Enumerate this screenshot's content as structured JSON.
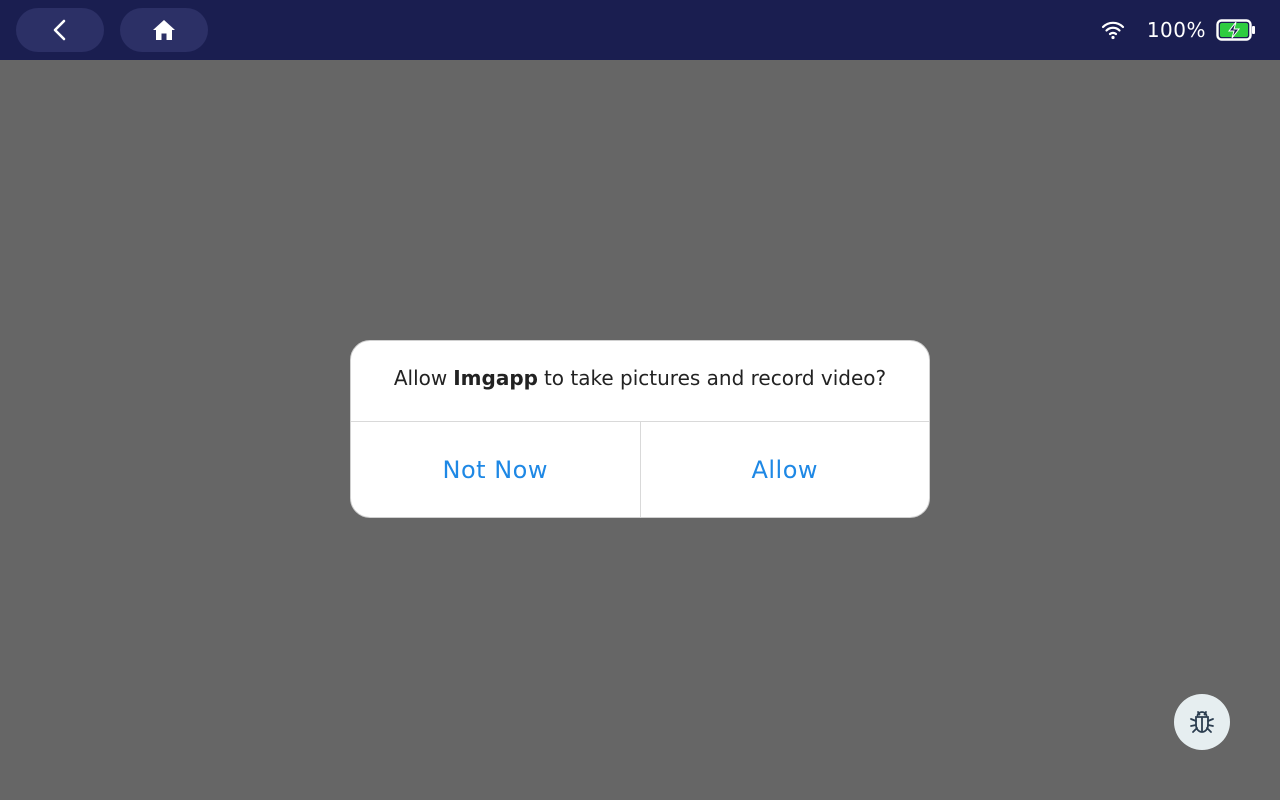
{
  "topbar": {
    "back_icon": "chevron-left-icon",
    "home_icon": "home-icon",
    "wifi_icon": "wifi-icon",
    "battery_percent": "100%",
    "battery_icon": "battery-charging-icon",
    "battery_level": 1.0
  },
  "dialog": {
    "message_prefix": "Allow",
    "app_name": "Imgapp",
    "message_suffix": "to take pictures and record video?",
    "not_now_label": "Not Now",
    "allow_label": "Allow"
  },
  "debug_button": {
    "icon": "bug-icon"
  },
  "colors": {
    "topbar_bg": "#1a1e50",
    "screen_bg": "#666666",
    "accent": "#1e88e5",
    "battery_fill": "#2ecc40"
  }
}
